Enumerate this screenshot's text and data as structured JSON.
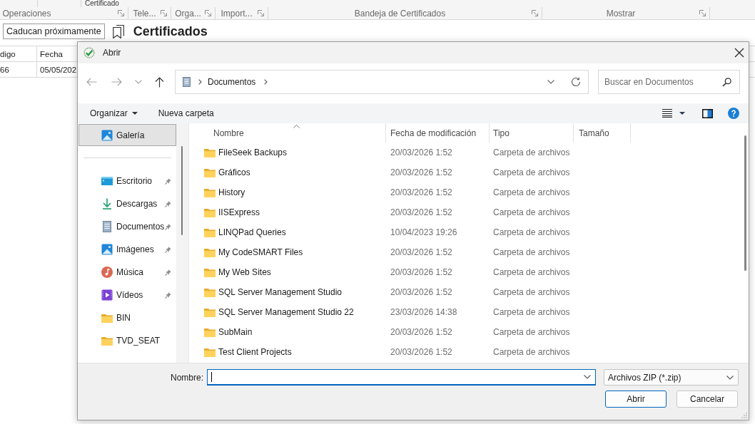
{
  "background_app": {
    "ribbon": {
      "top_label": "Certificado",
      "groups": [
        {
          "label": "Operaciones"
        },
        {
          "label": "Tele..."
        },
        {
          "label": "Orga..."
        },
        {
          "label": "Import..."
        },
        {
          "label": "Bandeja de Certificados"
        },
        {
          "label": "Mostrar"
        }
      ]
    },
    "filter": {
      "value": "Caducan próximamente"
    },
    "title": "Certificados",
    "table": {
      "columns": [
        "digo",
        "Fecha"
      ],
      "rows": [
        [
          "66",
          "05/05/202"
        ]
      ]
    }
  },
  "dialog": {
    "title": "Abrir",
    "address": {
      "path": [
        {
          "label": "Documentos"
        }
      ]
    },
    "search": {
      "placeholder": "Buscar en Documentos"
    },
    "toolbar": {
      "organize": "Organizar",
      "new_folder": "Nueva carpeta"
    },
    "nav_pane": {
      "sections": [
        {
          "items": [
            {
              "label": "Galería",
              "kind": "gallery",
              "selected": true,
              "pinned": false
            }
          ]
        },
        {
          "items": [
            {
              "label": "Escritorio",
              "kind": "desktop",
              "selected": false,
              "pinned": true
            },
            {
              "label": "Descargas",
              "kind": "downloads",
              "selected": false,
              "pinned": true
            },
            {
              "label": "Documentos",
              "kind": "documents",
              "selected": false,
              "pinned": true
            },
            {
              "label": "Imágenes",
              "kind": "pictures",
              "selected": false,
              "pinned": true
            },
            {
              "label": "Música",
              "kind": "music",
              "selected": false,
              "pinned": true
            },
            {
              "label": "Vídeos",
              "kind": "videos",
              "selected": false,
              "pinned": true
            },
            {
              "label": "BIN",
              "kind": "folder",
              "selected": false,
              "pinned": false
            },
            {
              "label": "TVD_SEAT",
              "kind": "folder",
              "selected": false,
              "pinned": false
            }
          ]
        }
      ]
    },
    "file_list": {
      "columns": [
        {
          "label": "Nombre",
          "sorted": true
        },
        {
          "label": "Fecha de modificación",
          "sorted": false
        },
        {
          "label": "Tipo",
          "sorted": false
        },
        {
          "label": "Tamaño",
          "sorted": false
        }
      ],
      "rows": [
        {
          "name": "FileSeek Backups",
          "modified": "20/03/2026 1:52",
          "type": "Carpeta de archivos"
        },
        {
          "name": "Gráficos",
          "modified": "20/03/2026 1:52",
          "type": "Carpeta de archivos"
        },
        {
          "name": "History",
          "modified": "20/03/2026 1:52",
          "type": "Carpeta de archivos"
        },
        {
          "name": "IISExpress",
          "modified": "20/03/2026 1:52",
          "type": "Carpeta de archivos"
        },
        {
          "name": "LINQPad Queries",
          "modified": "10/04/2023 19:26",
          "type": "Carpeta de archivos"
        },
        {
          "name": "My CodeSMART Files",
          "modified": "20/03/2026 1:52",
          "type": "Carpeta de archivos"
        },
        {
          "name": "My Web Sites",
          "modified": "20/03/2026 1:52",
          "type": "Carpeta de archivos"
        },
        {
          "name": "SQL Server Management Studio",
          "modified": "20/03/2026 1:52",
          "type": "Carpeta de archivos"
        },
        {
          "name": "SQL Server Management Studio 22",
          "modified": "23/03/2026 14:38",
          "type": "Carpeta de archivos"
        },
        {
          "name": "SubMain",
          "modified": "20/03/2026 1:52",
          "type": "Carpeta de archivos"
        },
        {
          "name": "Test Client Projects",
          "modified": "20/03/2026 1:52",
          "type": "Carpeta de archivos"
        }
      ]
    },
    "filename": {
      "label": "Nombre:",
      "focused": true
    },
    "file_type": {
      "value": "Archivos ZIP (*.zip)"
    },
    "buttons": [
      {
        "label": "Abrir",
        "default": true
      },
      {
        "label": "Cancelar",
        "default": false
      }
    ]
  }
}
